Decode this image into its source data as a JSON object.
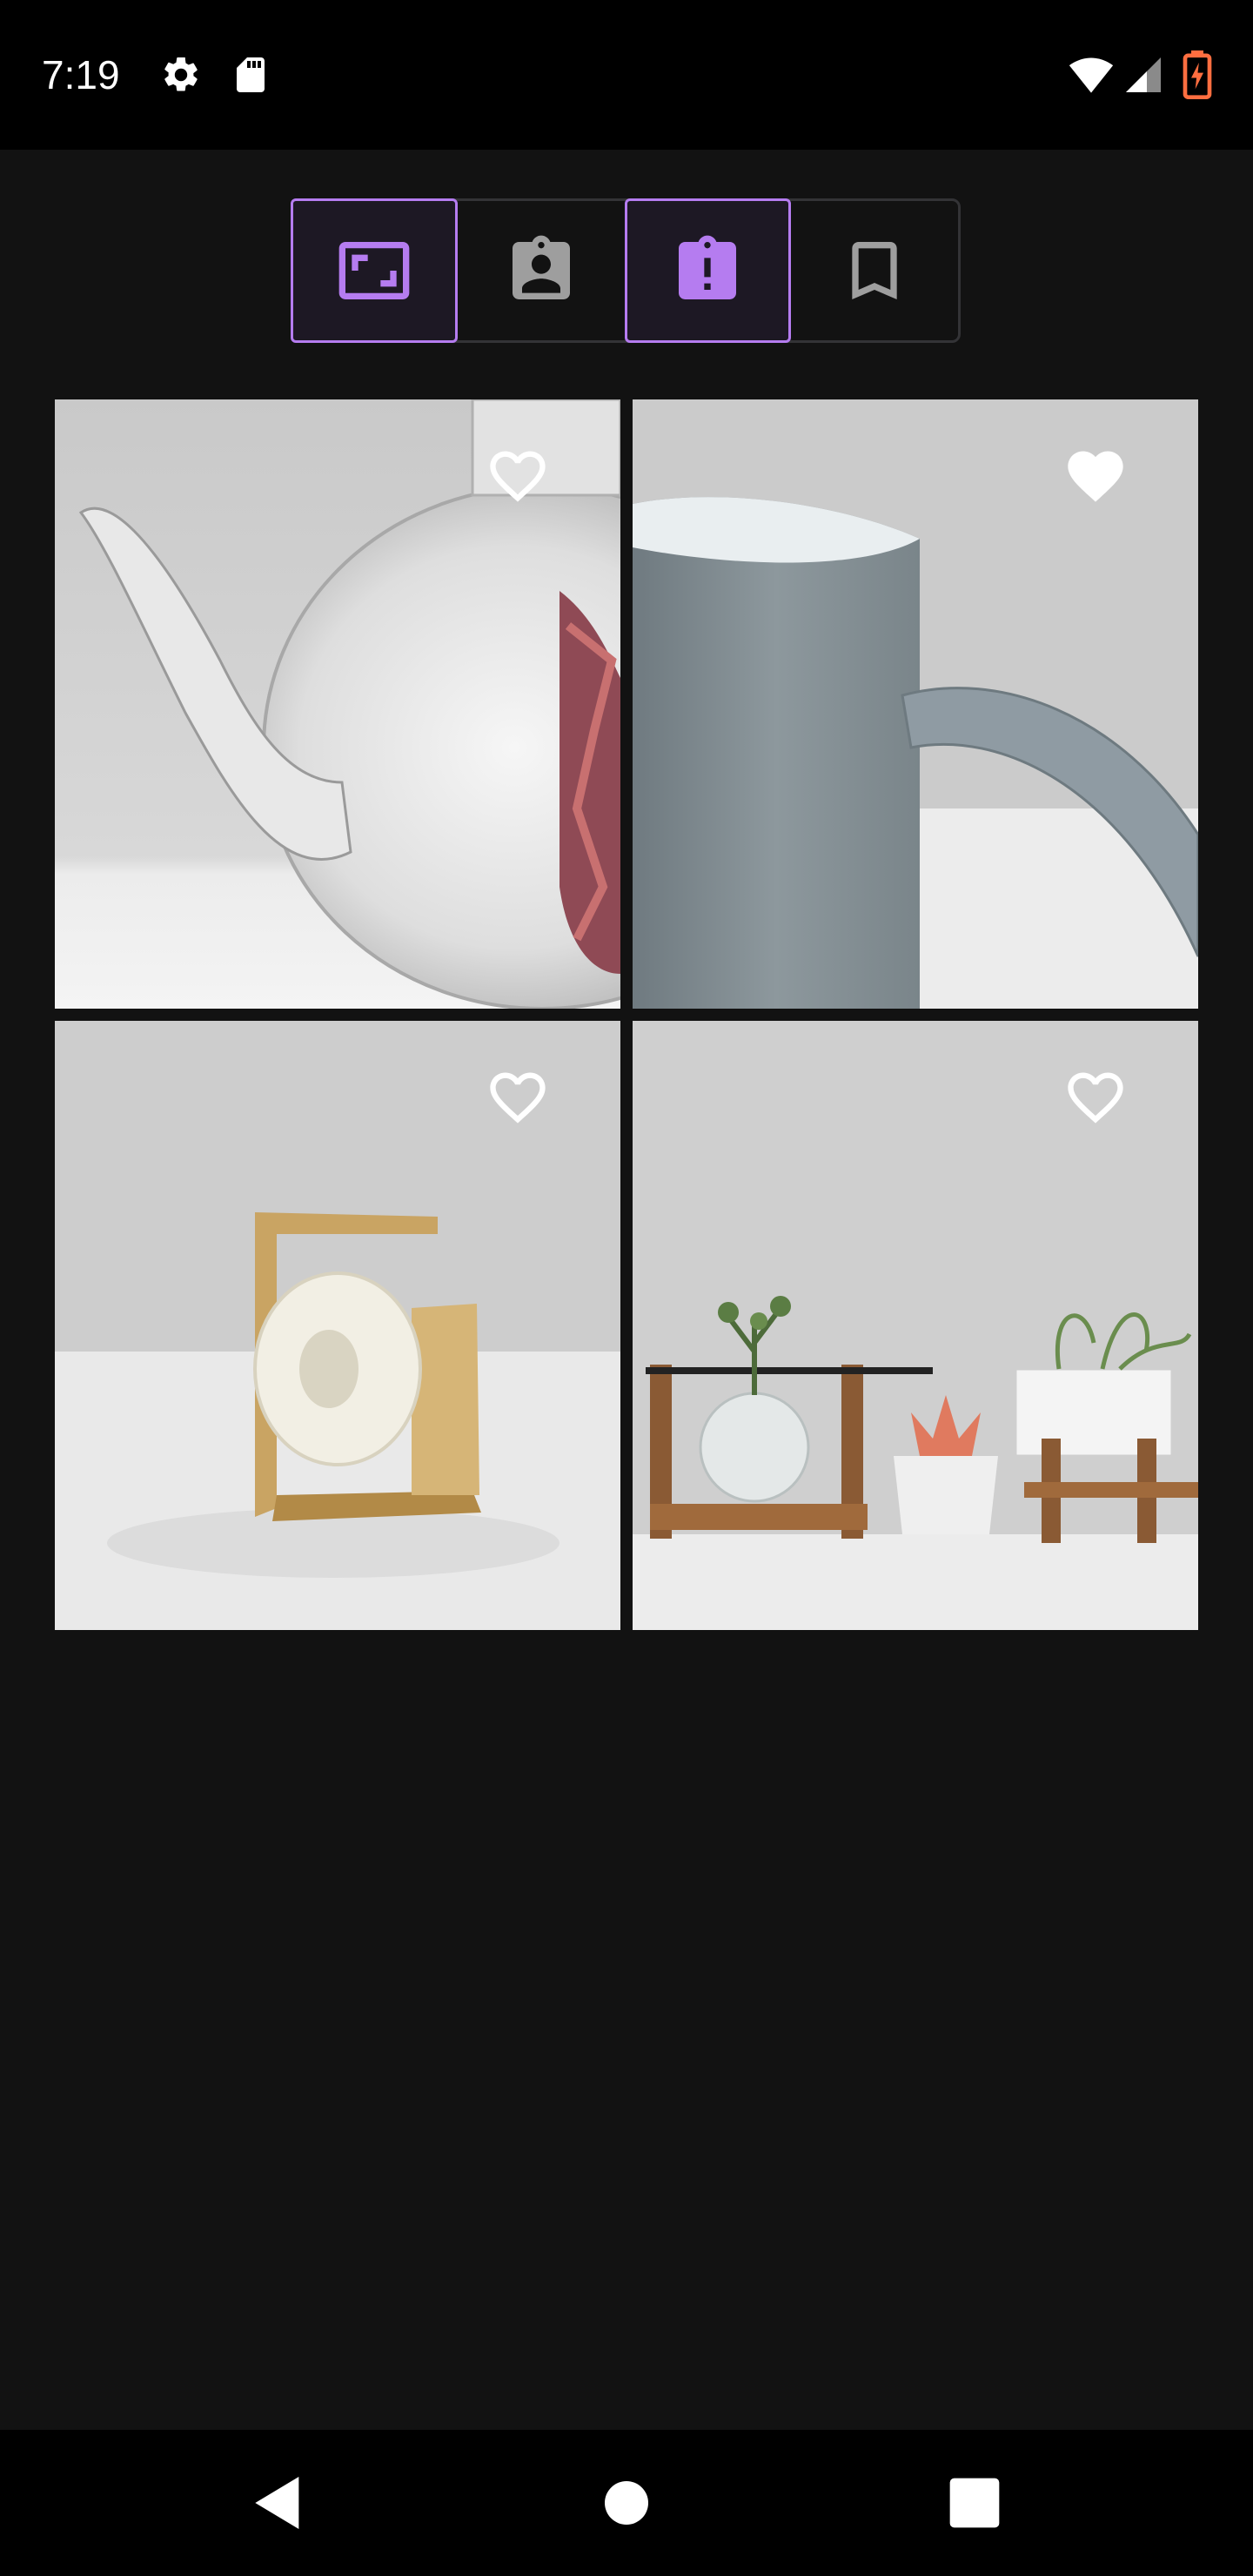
{
  "status_bar": {
    "time": "7:19",
    "icons": [
      "gear-icon",
      "sd-card-icon",
      "wifi-icon",
      "signal-icon",
      "battery-charging-icon"
    ]
  },
  "toggle_group": {
    "accent_color": "#b57cf0",
    "buttons": [
      {
        "icon": "aspect-ratio-icon",
        "selected": true
      },
      {
        "icon": "assignment-ind-icon",
        "selected": false
      },
      {
        "icon": "assignment-late-icon",
        "selected": true
      },
      {
        "icon": "bookmark-border-icon",
        "selected": false
      }
    ]
  },
  "grid": {
    "items": [
      {
        "image": "glass-teapot",
        "favorite": false
      },
      {
        "image": "grey-mug",
        "favorite": true
      },
      {
        "image": "tape-dispenser",
        "favorite": false
      },
      {
        "image": "plant-stands",
        "favorite": false
      }
    ]
  },
  "nav_bar": {
    "buttons": [
      "back-icon",
      "home-icon",
      "recents-icon"
    ]
  }
}
